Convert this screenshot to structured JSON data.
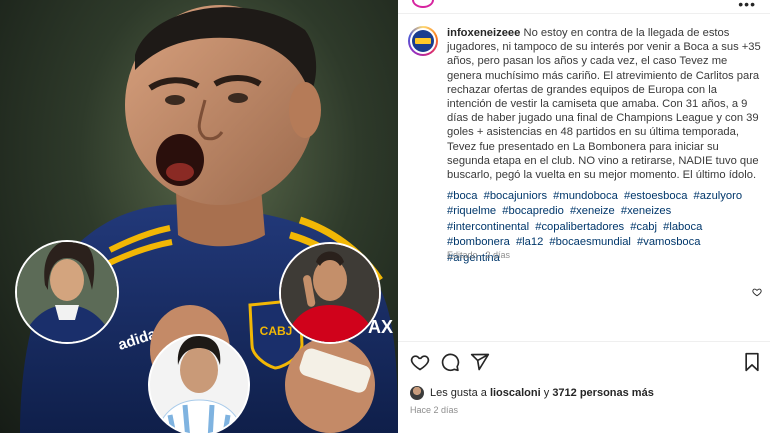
{
  "post": {
    "username": "infoxeneizeee",
    "caption": "No estoy en contra de la llegada de estos jugadores, ni tampoco de su interés por venir a Boca a sus +35 años, pero pasan los años y cada vez, el caso Tevez me genera muchísimo más cariño. El atrevimiento de Carlitos para rechazar ofertas de grandes equipos de Europa con la intención de vestir la camiseta que amaba. Con 31 años, a 9 días de haber jugado una final de Champions League y con 39 goles + asistencias en 48 partidos en su última temporada, Tevez fue presentado en La Bombonera para iniciar su segunda etapa en el club. NO vino a retirarse, NADIE tuvo que buscarlo, pegó la vuelta en su mejor momento. El último ídolo.",
    "hashtags": [
      "#boca",
      "#bocajuniors",
      "#mundoboca",
      "#estoesboca",
      "#azulyoro",
      "#riquelme",
      "#bocapredio",
      "#xeneize",
      "#xeneizes",
      "#intercontinental",
      "#copalibertadores",
      "#cabj",
      "#laboca",
      "#bombonera",
      "#la12",
      "#bocaesmundial",
      "#vamosboca",
      "#argentina"
    ],
    "edited": "Editado · 2 días",
    "likes": {
      "prefix": "Les gusta a",
      "user": "lioscaloni",
      "connector": "y",
      "count": "3712 personas más"
    },
    "posted_ago": "Hace 2 días"
  },
  "photo": {
    "jersey_text": "CABJ",
    "sleeve_brand": "adidas",
    "circle_badge": "AX"
  },
  "colors": {
    "link": "#00376b",
    "boca_blue": "#1a2f6b",
    "boca_gold": "#f2b705",
    "bayern_red": "#d0021b"
  },
  "icons": {
    "like": "heart-icon",
    "comment": "comment-icon",
    "share": "send-icon",
    "save": "bookmark-icon",
    "more": "more-dots-icon"
  }
}
